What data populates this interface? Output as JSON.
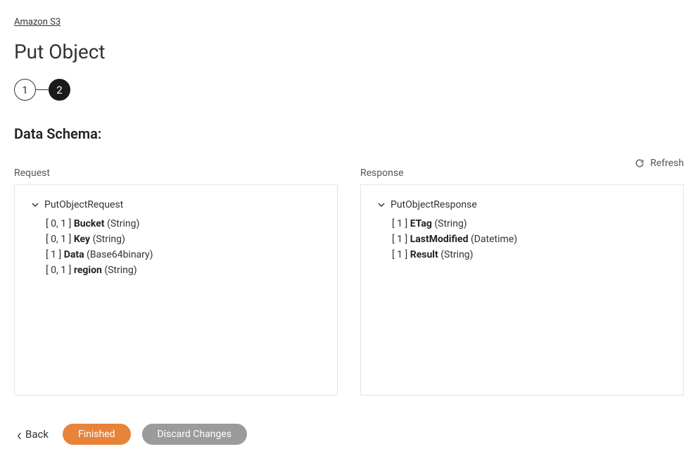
{
  "breadcrumb": "Amazon S3",
  "page_title": "Put Object",
  "stepper": {
    "step1": "1",
    "step2": "2"
  },
  "section_title": "Data Schema:",
  "refresh_label": "Refresh",
  "request": {
    "label": "Request",
    "root": "PutObjectRequest",
    "fields": [
      {
        "card": "[ 0, 1 ]",
        "name": "Bucket",
        "type": "(String)"
      },
      {
        "card": "[ 0, 1 ]",
        "name": "Key",
        "type": "(String)"
      },
      {
        "card": "[ 1 ]",
        "name": "Data",
        "type": "(Base64binary)"
      },
      {
        "card": "[ 0, 1 ]",
        "name": "region",
        "type": "(String)"
      }
    ]
  },
  "response": {
    "label": "Response",
    "root": "PutObjectResponse",
    "fields": [
      {
        "card": "[ 1 ]",
        "name": "ETag",
        "type": "(String)"
      },
      {
        "card": "[ 1 ]",
        "name": "LastModified",
        "type": "(Datetime)"
      },
      {
        "card": "[ 1 ]",
        "name": "Result",
        "type": "(String)"
      }
    ]
  },
  "buttons": {
    "back": "Back",
    "finished": "Finished",
    "discard": "Discard Changes"
  }
}
